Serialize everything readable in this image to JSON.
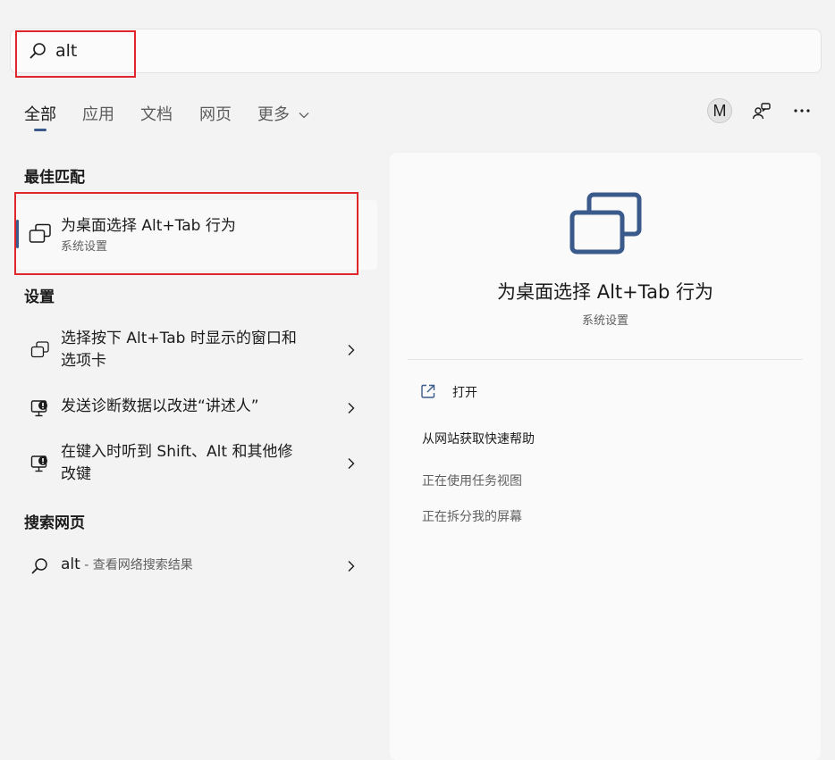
{
  "search": {
    "value": "alt",
    "icon": "search-icon"
  },
  "tabs": [
    {
      "label": "全部",
      "active": true
    },
    {
      "label": "应用"
    },
    {
      "label": "文档"
    },
    {
      "label": "网页"
    },
    {
      "label": "更多"
    }
  ],
  "header": {
    "avatar_letter": "M"
  },
  "sections": {
    "best_match": "最佳匹配",
    "settings": "设置",
    "web": "搜索网页"
  },
  "best_match": {
    "title": "为桌面选择 Alt+Tab 行为",
    "subtitle": "系统设置"
  },
  "settings_items": [
    {
      "line1": "选择按下 Alt+Tab 时显示的窗口和",
      "line2": "选项卡"
    },
    {
      "line1": "发送诊断数据以改进“讲述人”"
    },
    {
      "line1": "在键入时听到 Shift、Alt 和其他修",
      "line2": "改键"
    }
  ],
  "web_item": {
    "query": "alt",
    "suffix": " - 查看网络搜索结果"
  },
  "detail": {
    "title": "为桌面选择 Alt+Tab 行为",
    "subtitle": "系统设置",
    "open_label": "打开",
    "help_heading": "从网站获取快速帮助",
    "links": [
      "正在使用任务视图",
      "正在拆分我的屏幕"
    ]
  },
  "colors": {
    "accent": "#3a5a8c",
    "highlight_box": "#e0262b"
  }
}
